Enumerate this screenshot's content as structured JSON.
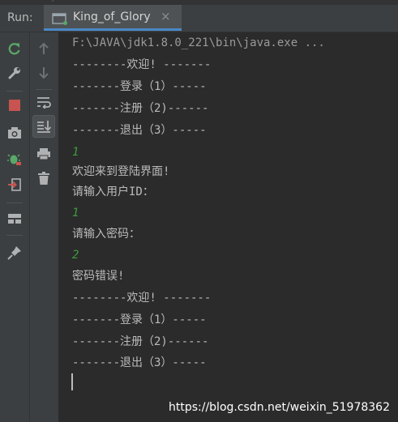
{
  "header": {
    "run_label": "Run:",
    "tab_title": "King_of_Glory",
    "tab_close": "×"
  },
  "toolbar_left": [
    {
      "name": "rerun-icon"
    },
    {
      "name": "wrench-icon"
    },
    {
      "name": "stop-icon"
    },
    {
      "name": "camera-icon"
    },
    {
      "name": "debug-icon"
    },
    {
      "name": "exit-icon"
    },
    {
      "name": "layout-icon"
    },
    {
      "name": "pin-icon"
    }
  ],
  "toolbar_right": [
    {
      "name": "up-arrow-icon"
    },
    {
      "name": "down-arrow-icon"
    },
    {
      "name": "soft-wrap-icon"
    },
    {
      "name": "scroll-to-end-icon"
    },
    {
      "name": "print-icon"
    },
    {
      "name": "trash-icon"
    }
  ],
  "console": {
    "lines": [
      {
        "text": "F:\\JAVA\\jdk1.8.0_221\\bin\\java.exe ...",
        "kind": "path"
      },
      {
        "text": "--------欢迎! -------",
        "kind": "out"
      },
      {
        "text": "-------登录（1）-----",
        "kind": "out"
      },
      {
        "text": "-------注册（2)------",
        "kind": "out"
      },
      {
        "text": "-------退出（3）-----",
        "kind": "out"
      },
      {
        "text": "1",
        "kind": "input"
      },
      {
        "text": "欢迎来到登陆界面!",
        "kind": "out"
      },
      {
        "text": "请输入用户ID：",
        "kind": "out"
      },
      {
        "text": "1",
        "kind": "input"
      },
      {
        "text": "请输入密码：",
        "kind": "out"
      },
      {
        "text": "2",
        "kind": "input"
      },
      {
        "text": "密码错误!",
        "kind": "out"
      },
      {
        "text": "--------欢迎! -------",
        "kind": "out"
      },
      {
        "text": "-------登录（1）-----",
        "kind": "out"
      },
      {
        "text": "-------注册（2)------",
        "kind": "out"
      },
      {
        "text": "-------退出（3）-----",
        "kind": "out"
      }
    ]
  },
  "watermark": "https://blog.csdn.net/weixin_51978362",
  "colors": {
    "background": "#2b2b2b",
    "panel": "#3c3f41",
    "output_text": "#bbbbbb",
    "input_text": "#3d9d3d",
    "tab_underline": "#4a88c7"
  }
}
